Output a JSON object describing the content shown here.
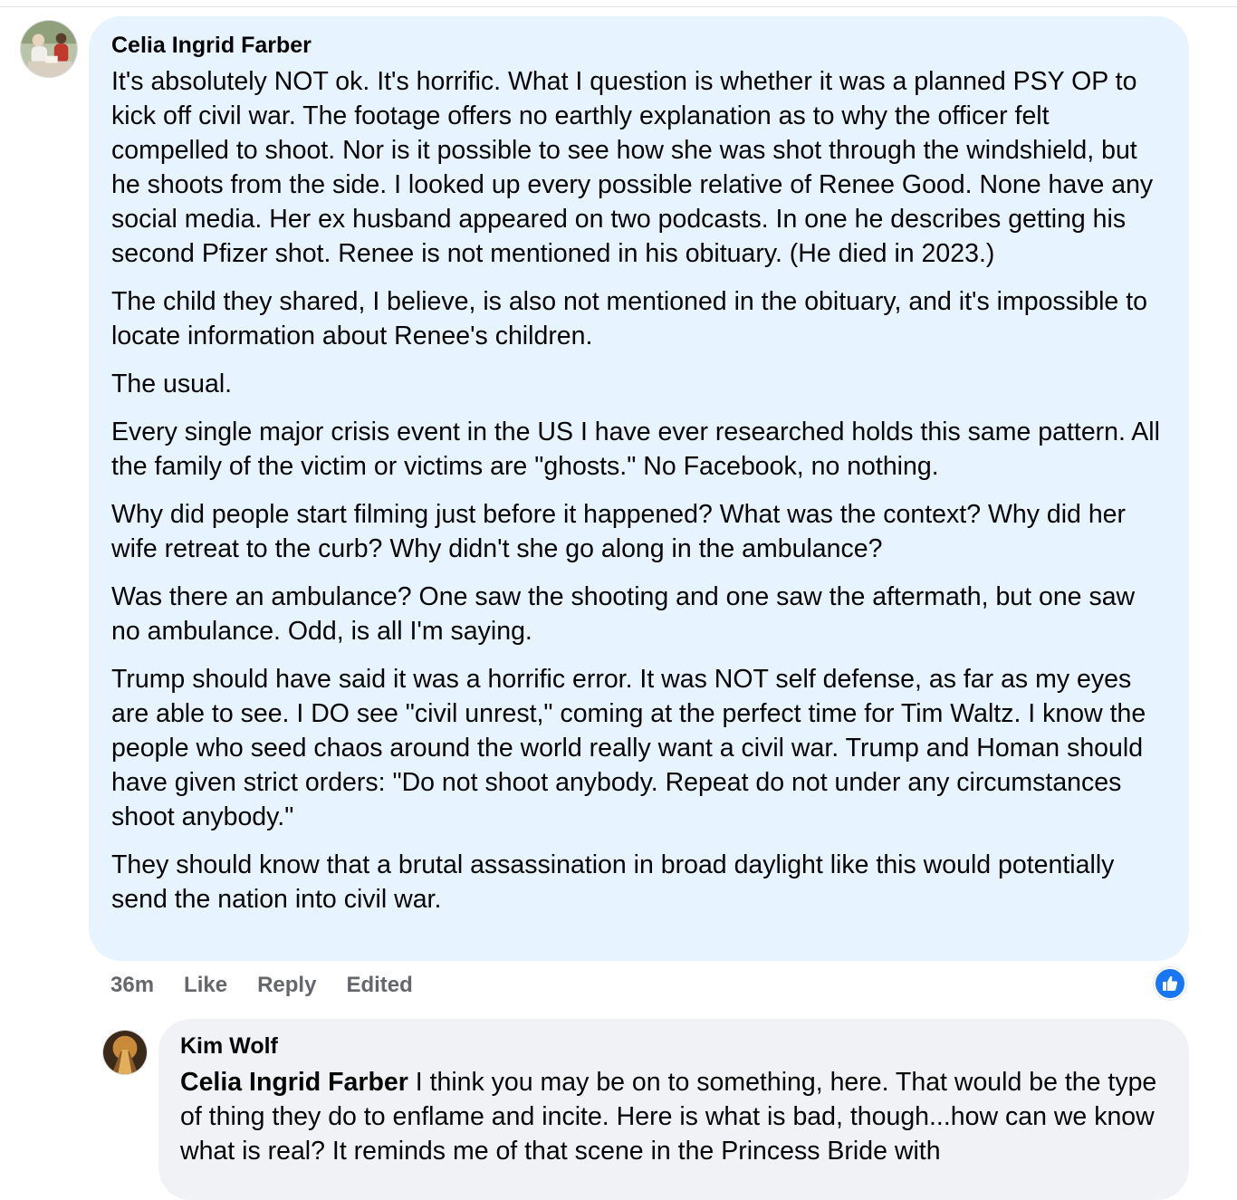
{
  "comment": {
    "author": "Celia Ingrid Farber",
    "avatar_icon": "user-avatar-photo",
    "paragraphs": [
      "It's absolutely NOT ok. It's horrific. What I question is whether it was a planned PSY OP to kick off civil war. The footage offers no earthly explanation as to why the officer felt compelled to shoot. Nor is it possible to see how she was shot through the windshield, but he shoots from the side. I looked up every possible relative of Renee Good. None have any social media. Her ex husband appeared on two podcasts. In one he describes getting his second Pfizer shot. Renee is not mentioned in his obituary. (He died in 2023.)",
      "The child they shared, I believe, is also not mentioned in the obituary, and it's impossible to locate information about Renee's children.",
      "The usual.",
      "Every single major crisis event in the US I have ever researched holds this same pattern. All the family of the victim or victims are \"ghosts.\" No Facebook, no nothing.",
      "Why did people start filming just before it happened? What was the context? Why did her wife retreat to the curb? Why didn't she go along in the ambulance?",
      "Was there an ambulance? One saw the shooting and one saw the aftermath, but one saw no ambulance. Odd, is all I'm saying.",
      "Trump should have said it was a horrific error. It was NOT self defense, as far as my eyes are able to see. I DO see \"civil unrest,\" coming at the perfect time for Tim Waltz. I know the people who seed chaos around the world really want a civil war. Trump and Homan should have given strict orders: \"Do not shoot anybody. Repeat do not under any circumstances shoot anybody.\"",
      "They should know that a brutal assassination in broad daylight like this would potentially send the nation into civil war."
    ],
    "actions": {
      "time": "36m",
      "like": "Like",
      "reply": "Reply",
      "edited": "Edited"
    },
    "reaction_icon": "like-thumbs-up-icon",
    "reaction_color": "#1877f2",
    "bubble_color": "#e7f3ff"
  },
  "reply": {
    "author": "Kim Wolf",
    "avatar_icon": "user-avatar-photo",
    "mention": "Celia Ingrid Farber",
    "text": " I think you may be on to something, here. That would be the type of thing they do to enflame and incite. Here is what is bad, though...how can we know what is real? It reminds me of that scene in the Princess Bride with",
    "bubble_color": "#f0f2f5"
  }
}
